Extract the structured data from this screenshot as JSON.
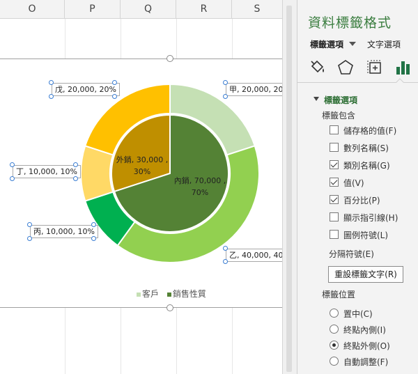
{
  "columns": [
    "O",
    "P",
    "Q",
    "R",
    "S"
  ],
  "chart_data": {
    "type": "pie",
    "variant": "doughnut-with-inner-pie",
    "inner": {
      "categories": [
        "外銷",
        "內銷"
      ],
      "values": [
        30000,
        70000
      ],
      "percents": [
        "30%",
        "70%"
      ],
      "colors": [
        "#bf8f00",
        "#548235"
      ]
    },
    "outer": {
      "categories": [
        "甲",
        "乙",
        "丙",
        "丁",
        "戊"
      ],
      "values": [
        20000,
        40000,
        10000,
        10000,
        20000
      ],
      "percents": [
        "20%",
        "40%",
        "10%",
        "10%",
        "20%"
      ],
      "colors": [
        "#c5e0b4",
        "#92d050",
        "#00b050",
        "#ffd966",
        "#ffc000"
      ]
    },
    "legend": [
      {
        "name": "客戶",
        "color": "#c5e0b4"
      },
      {
        "name": "銷售性質",
        "color": "#548235"
      }
    ],
    "legend_position": "bottom"
  },
  "labels": {
    "outer": [
      "甲, 20,000, 20",
      "乙, 40,000, 40",
      "丙, 10,000, 10%",
      "丁, 10,000, 10%",
      "戊, 20,000, 20%"
    ],
    "inner": [
      {
        "line1": "外銷, 30,000 ,",
        "line2": "30%"
      },
      {
        "line1": "內銷, 70,000 ,",
        "line2": "70%"
      }
    ]
  },
  "pane": {
    "title": "資料標籤格式",
    "tab_label_options": "標籤選項",
    "tab_text_options": "文字選項",
    "icons": [
      "fill-bucket-icon",
      "pentagon-icon",
      "size-properties-icon",
      "bar-chart-icon"
    ],
    "section_label_options": "標籤選項",
    "label_contains": "標籤包含",
    "checkboxes": [
      {
        "label": "儲存格的值(F)",
        "checked": false
      },
      {
        "label": "數列名稱(S)",
        "checked": false
      },
      {
        "label": "類別名稱(G)",
        "checked": true
      },
      {
        "label": "值(V)",
        "checked": true
      },
      {
        "label": "百分比(P)",
        "checked": true
      },
      {
        "label": "顯示指引線(H)",
        "checked": false
      },
      {
        "label": "圖例符號(L)",
        "checked": false
      }
    ],
    "separator": "分隔符號(E)",
    "reset_button": "重設標籤文字(R)",
    "label_position": "標籤位置",
    "radios": [
      {
        "label": "置中(C)",
        "checked": false
      },
      {
        "label": "終點內側(I)",
        "checked": false
      },
      {
        "label": "終點外側(O)",
        "checked": true
      },
      {
        "label": "自動調整(F)",
        "checked": false
      }
    ]
  }
}
